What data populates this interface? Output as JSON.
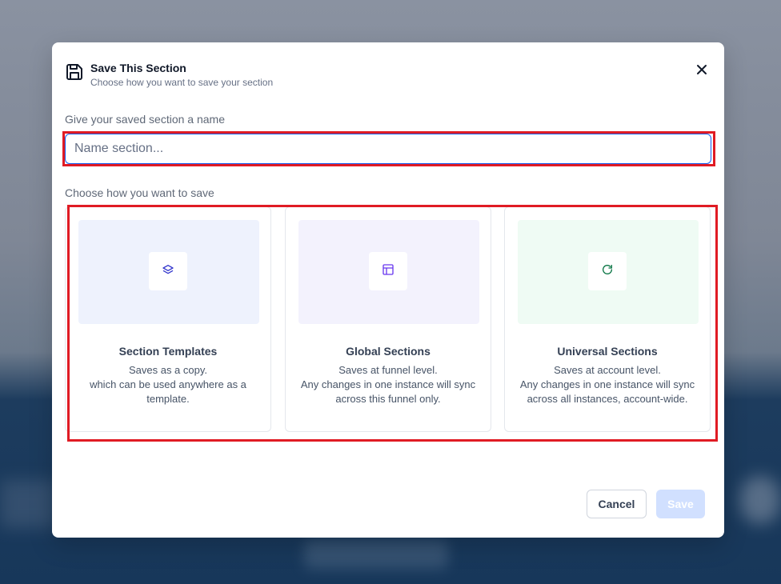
{
  "dialog": {
    "title": "Save This Section",
    "subtitle": "Choose how you want to save your section",
    "icon": "save-icon",
    "close_icon": "close-icon"
  },
  "name_field": {
    "label": "Give your saved section a name",
    "placeholder": "Name section...",
    "value": ""
  },
  "save_options": {
    "label": "Choose how you want to save",
    "cards": [
      {
        "title": "Section Templates",
        "description": [
          "Saves as a copy.",
          "which can be used anywhere as a template."
        ],
        "icon": "layers-icon",
        "preview_color": "#eef2fd",
        "icon_color": "#3538cd"
      },
      {
        "title": "Global Sections",
        "description": [
          "Saves at funnel level.",
          "Any changes in one instance will sync across this funnel only."
        ],
        "icon": "layout-icon",
        "preview_color": "#f3f2fd",
        "icon_color": "#6938ef"
      },
      {
        "title": "Universal Sections",
        "description": [
          "Saves at account level.",
          "Any changes in one instance will sync across all instances, account-wide."
        ],
        "icon": "refresh-icon",
        "preview_color": "#effbf4",
        "icon_color": "#087443"
      }
    ]
  },
  "footer": {
    "cancel_label": "Cancel",
    "save_label": "Save"
  },
  "colors": {
    "accent": "#155eef",
    "highlight": "#e01b24",
    "save_disabled": "#d1e0ff"
  }
}
